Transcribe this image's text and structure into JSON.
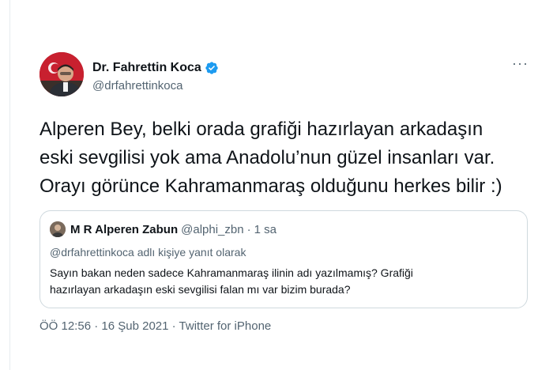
{
  "tweet": {
    "display_name": "Dr. Fahrettin Koca",
    "handle": "@drfahrettinkoca",
    "more_symbol": "···",
    "text": "Alperen Bey, belki orada grafiği hazırlayan arkadaşın\neski sevgilisi yok ama Anadolu’nun güzel insanları var.\nOrayı görünce Kahramanmaraş olduğunu herkes bilir :)",
    "verified_icon": "verified-badge",
    "avatar_icon": "profile-photo"
  },
  "quote": {
    "display_name": "M R Alperen Zabun",
    "handle": "@alphi_zbn",
    "separator": "·",
    "time": "1 sa",
    "reply_to": "@drfahrettinkoca adlı kişiye yanıt olarak",
    "text": "Sayın bakan neden sadece Kahramanmaraş ilinin adı yazılmamış? Grafiği\nhazırlayan arkadaşın eski sevgilisi falan mı var bizim burada?"
  },
  "meta": {
    "time": "ÖÖ 12:56",
    "sep1": " · ",
    "date": "16 Şub 2021",
    "sep2": " · ",
    "source": "Twitter for iPhone"
  },
  "colors": {
    "text_primary": "#0f1419",
    "text_secondary": "#536471",
    "verified_blue": "#1d9bf0",
    "border": "#cfd9de"
  }
}
